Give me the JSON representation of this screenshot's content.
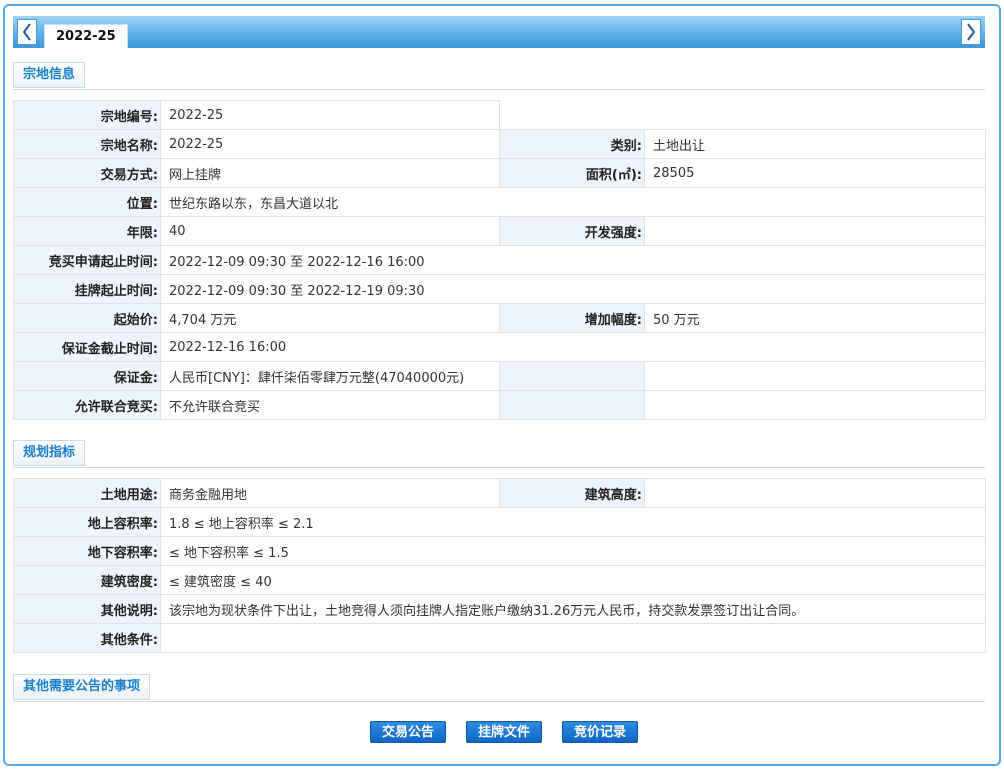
{
  "tab": {
    "active_label": "2022-25"
  },
  "sections": {
    "basic_title": "宗地信息",
    "planning_title": "规划指标",
    "other_title": "其他需要公告的事项"
  },
  "basic": {
    "parcel_no_label": "宗地编号:",
    "parcel_no": "2022-25",
    "parcel_name_label": "宗地名称:",
    "parcel_name": "2022-25",
    "category_label": "类别:",
    "category": "土地出让",
    "method_label": "交易方式:",
    "method": "网上挂牌",
    "area_label": "面积(㎡):",
    "area": "28505",
    "location_label": "位置:",
    "location": "世纪东路以东，东昌大道以北",
    "term_label": "年限:",
    "term": "40",
    "intensity_label": "开发强度:",
    "intensity": "",
    "bid_apply_label": "竞买申请起止时间:",
    "bid_apply": "2022-12-09 09:30 至 2022-12-16 16:00",
    "listing_label": "挂牌起止时间:",
    "listing": "2022-12-09 09:30 至 2022-12-19 09:30",
    "start_price_label": "起始价:",
    "start_price": "4,704 万元",
    "increment_label": "增加幅度:",
    "increment": "50 万元",
    "deposit_deadline_label": "保证金截止时间:",
    "deposit_deadline": "2022-12-16 16:00",
    "deposit_label": "保证金:",
    "deposit": "人民币[CNY]：肆仟柒佰零肆万元整(47040000元)",
    "joint_bid_label": "允许联合竞买:",
    "joint_bid": "不允许联合竞买"
  },
  "planning": {
    "land_use_label": "土地用途:",
    "land_use": "商务金融用地",
    "building_height_label": "建筑高度:",
    "building_height": "",
    "far_above_label": "地上容积率:",
    "far_above": "1.8 ≤ 地上容积率 ≤ 2.1",
    "far_below_label": "地下容积率:",
    "far_below": "≤ 地下容积率 ≤ 1.5",
    "density_label": "建筑密度:",
    "density": "≤ 建筑密度 ≤ 40",
    "notes_label": "其他说明:",
    "notes": "该宗地为现状条件下出让，土地竞得人须向挂牌人指定账户缴纳31.26万元人民币，持交款发票签订出让合同。",
    "other_conditions_label": "其他条件:",
    "other_conditions": ""
  },
  "actions": {
    "announcement": "交易公告",
    "listing_docs": "挂牌文件",
    "bid_records": "竞价记录"
  },
  "colors": {
    "accent": "#1a7fcf",
    "tabbar": "#5eb0e8",
    "button": "#0f66c5",
    "label_bg": "#eef4fb"
  },
  "icons": {
    "prev": "chevron-left-icon",
    "next": "chevron-right-icon"
  }
}
